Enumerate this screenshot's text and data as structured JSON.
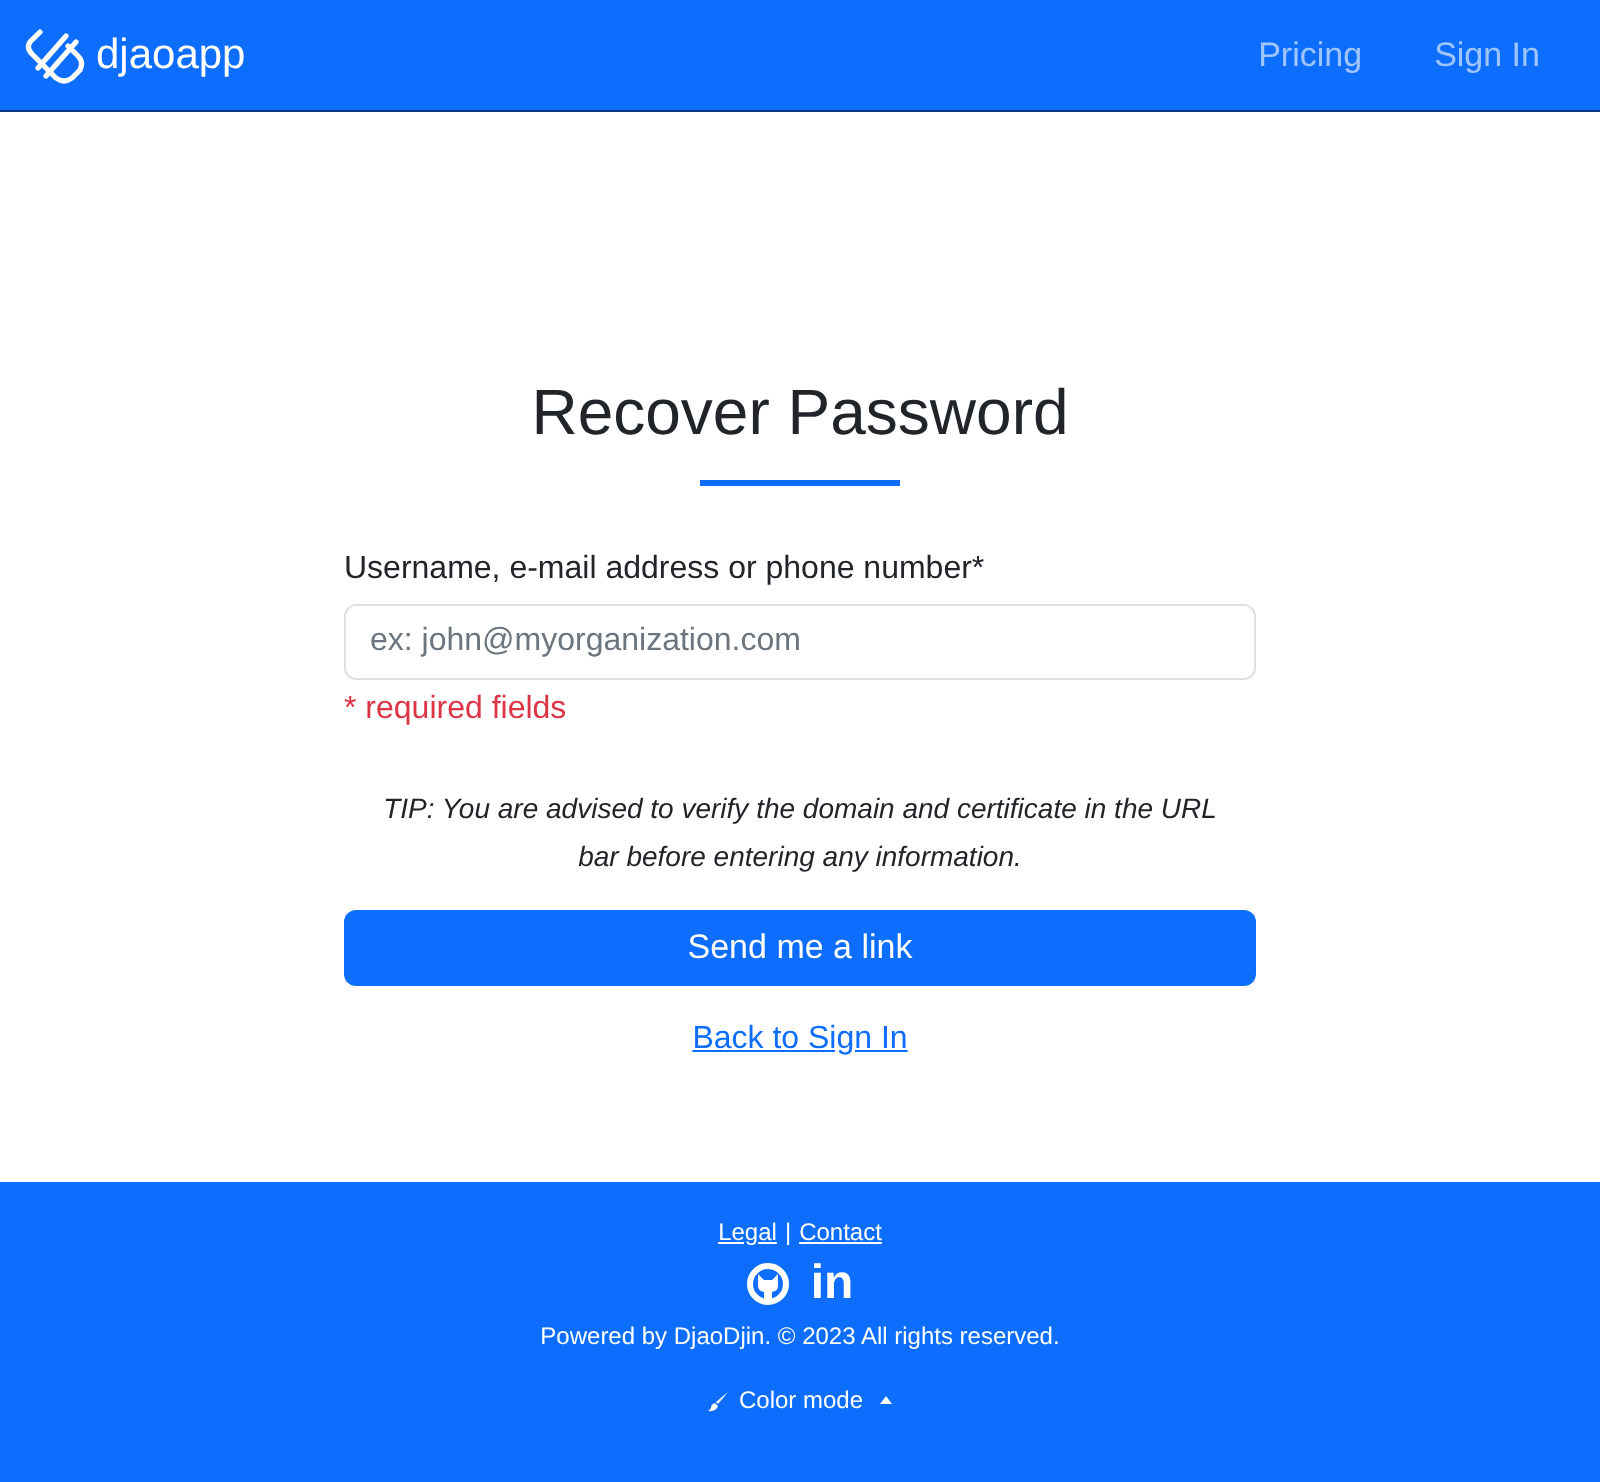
{
  "header": {
    "brand": "djaoapp",
    "nav": [
      {
        "label": "Pricing"
      },
      {
        "label": "Sign In"
      }
    ]
  },
  "form": {
    "title": "Recover Password",
    "field": {
      "label": "Username, e-mail address or phone number*",
      "placeholder": "ex: john@myorganization.com"
    },
    "required_note": "* required fields",
    "tip": "TIP: You are advised to verify the domain and certificate in the URL bar before entering any information.",
    "submit": "Send me a link",
    "back_link": "Back to Sign In"
  },
  "footer": {
    "links": [
      "Legal",
      "Contact"
    ],
    "separator": "|",
    "linkedin": "in",
    "copyright": "Powered by DjaoDjin. © 2023 All rights reserved.",
    "color_mode": "Color mode"
  }
}
